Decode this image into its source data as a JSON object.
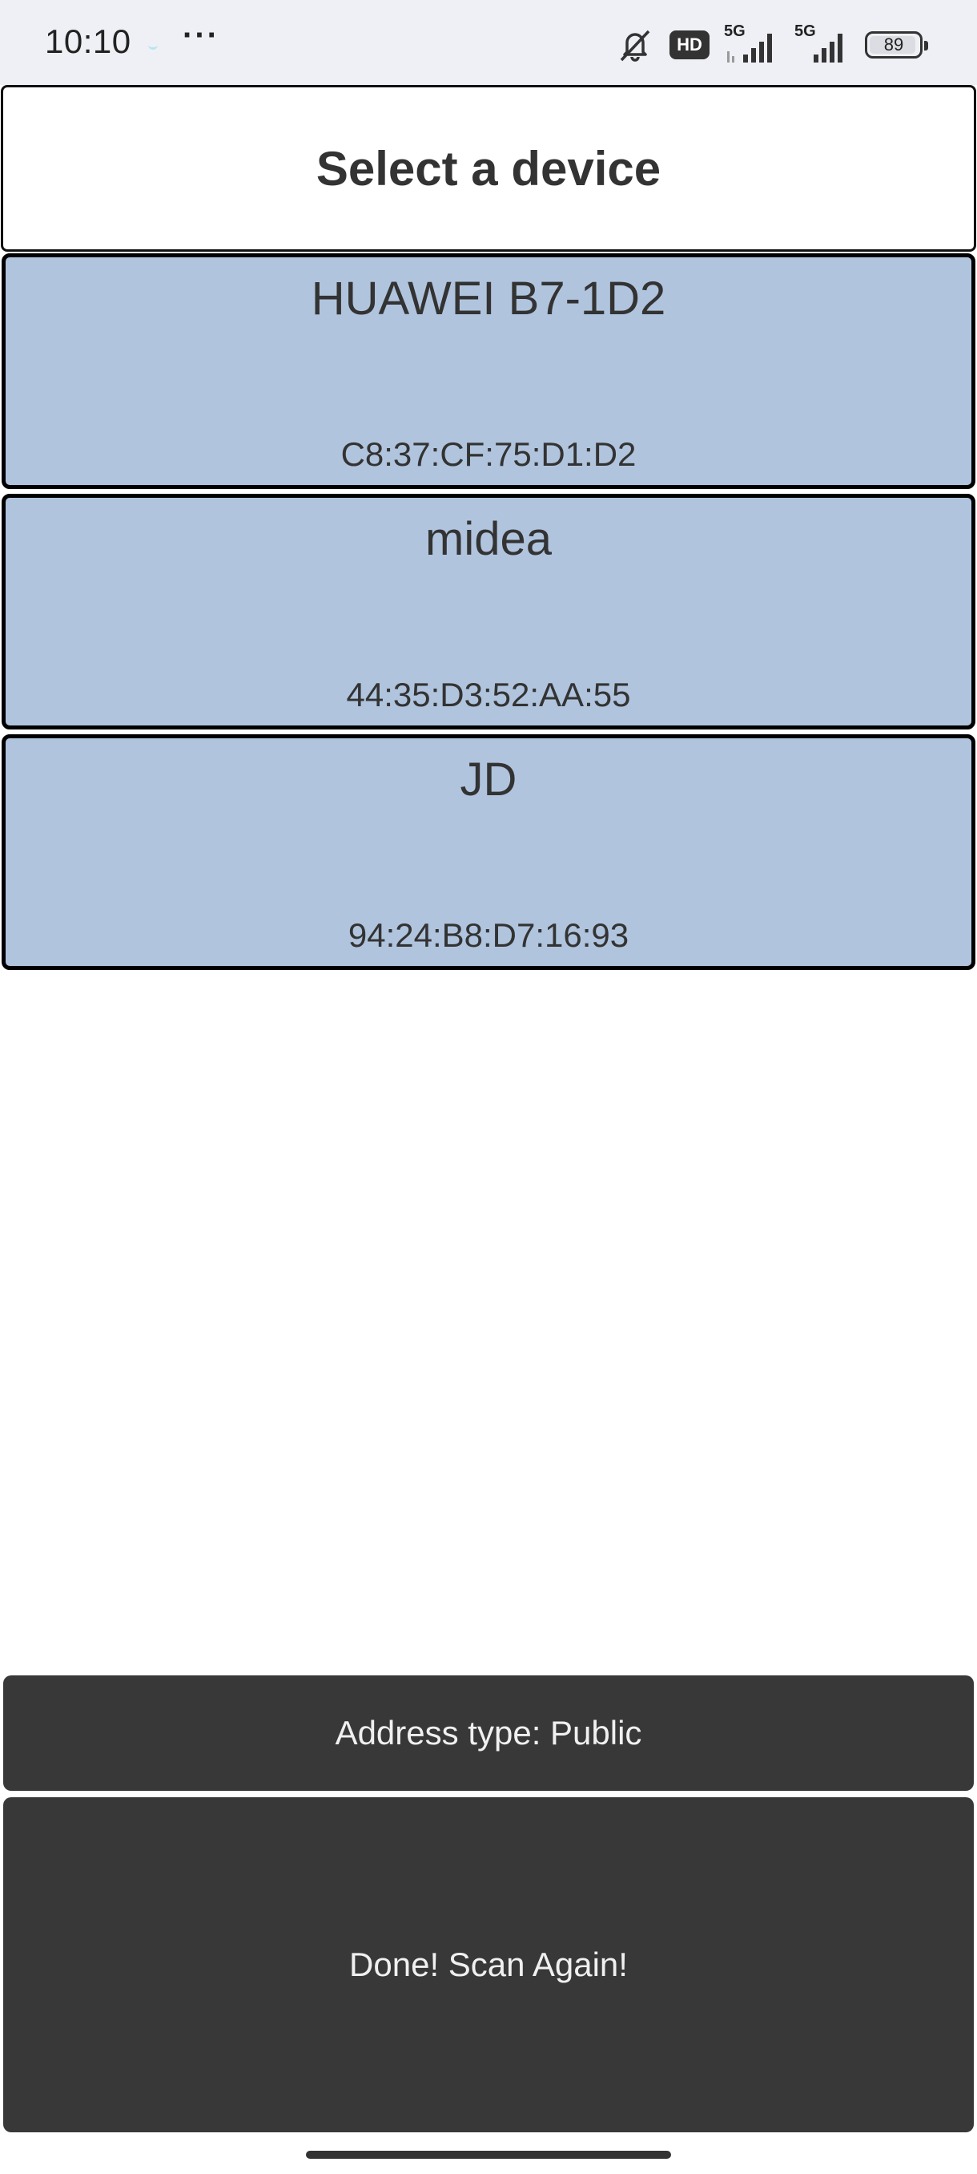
{
  "status_bar": {
    "time": "10:10",
    "overflow_dots": "···",
    "hd_label": "HD",
    "signal_1_label": "5G",
    "signal_2_label": "5G",
    "battery_level": "89",
    "icons": [
      "bell-muted-icon",
      "hd-icon",
      "signal-5g-icon",
      "signal-5g-icon",
      "battery-icon"
    ]
  },
  "header": {
    "title": "Select a device"
  },
  "devices": [
    {
      "name": "HUAWEI B7-1D2",
      "address": "C8:37:CF:75:D1:D2"
    },
    {
      "name": "midea",
      "address": "44:35:D3:52:AA:55"
    },
    {
      "name": "JD",
      "address": "94:24:B8:D7:16:93"
    }
  ],
  "footer": {
    "address_type": "Address type: Public",
    "scan_button_label": "Done! Scan Again!"
  },
  "colors": {
    "status_bar_bg": "#eff0f5",
    "device_card_bg": "#b0c4de",
    "button_bg": "#383838"
  }
}
